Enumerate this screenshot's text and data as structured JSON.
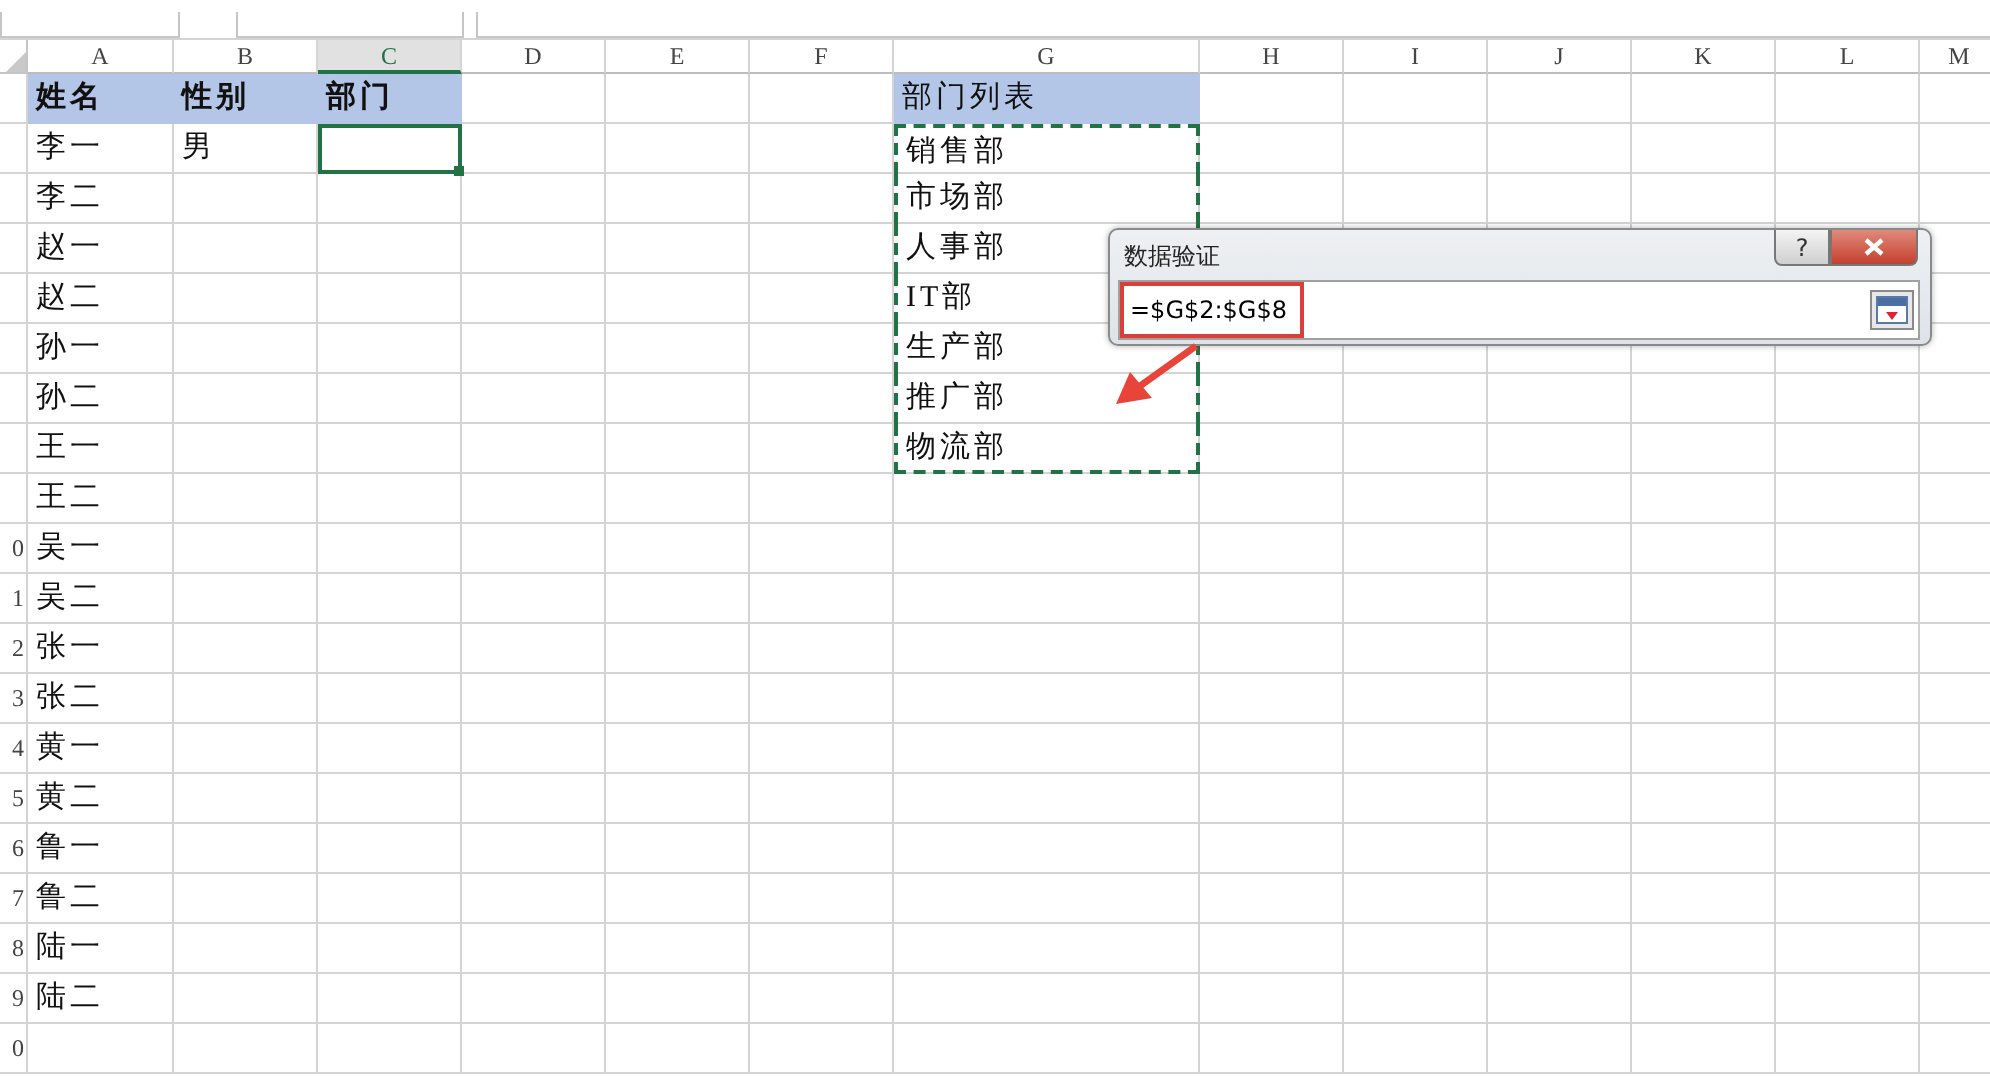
{
  "columns": [
    {
      "label": "A",
      "selected": false
    },
    {
      "label": "B",
      "selected": false
    },
    {
      "label": "C",
      "selected": true
    },
    {
      "label": "D",
      "selected": false
    },
    {
      "label": "E",
      "selected": false
    },
    {
      "label": "F",
      "selected": false
    },
    {
      "label": "G",
      "selected": false
    },
    {
      "label": "H",
      "selected": false
    },
    {
      "label": "I",
      "selected": false
    },
    {
      "label": "J",
      "selected": false
    },
    {
      "label": "K",
      "selected": false
    },
    {
      "label": "L",
      "selected": false
    },
    {
      "label": "M",
      "selected": false
    }
  ],
  "rows": [
    {
      "cells": [
        {
          "text": "姓名",
          "kind": "header"
        },
        {
          "text": "性别",
          "kind": "header"
        },
        {
          "text": "部门",
          "kind": "header"
        },
        null,
        null,
        null,
        {
          "text": "部门列表",
          "kind": "list-header"
        }
      ]
    },
    {
      "cells": [
        {
          "text": "李一"
        },
        {
          "text": "男"
        },
        {
          "selected": true
        },
        null,
        null,
        null,
        {
          "text": "销售部",
          "copied": true
        }
      ]
    },
    {
      "cells": [
        {
          "text": "李二"
        },
        null,
        null,
        null,
        null,
        null,
        {
          "text": "市场部",
          "copied": true
        }
      ]
    },
    {
      "cells": [
        {
          "text": "赵一"
        },
        null,
        null,
        null,
        null,
        null,
        {
          "text": "人事部",
          "copied": true
        }
      ]
    },
    {
      "cells": [
        {
          "text": "赵二"
        },
        null,
        null,
        null,
        null,
        null,
        {
          "text": "IT部",
          "copied": true
        }
      ]
    },
    {
      "cells": [
        {
          "text": "孙一"
        },
        null,
        null,
        null,
        null,
        null,
        {
          "text": "生产部",
          "copied": true
        }
      ]
    },
    {
      "cells": [
        {
          "text": "孙二"
        },
        null,
        null,
        null,
        null,
        null,
        {
          "text": "推广部",
          "copied": true
        }
      ]
    },
    {
      "cells": [
        {
          "text": "王一"
        },
        null,
        null,
        null,
        null,
        null,
        {
          "text": "物流部",
          "copied": true
        }
      ]
    },
    {
      "cells": [
        {
          "text": "王二"
        }
      ]
    },
    {
      "row_label": "0",
      "cells": [
        {
          "text": "吴一"
        }
      ]
    },
    {
      "row_label": "1",
      "cells": [
        {
          "text": "吴二"
        }
      ]
    },
    {
      "row_label": "2",
      "cells": [
        {
          "text": "张一"
        }
      ]
    },
    {
      "row_label": "3",
      "cells": [
        {
          "text": "张二"
        }
      ]
    },
    {
      "row_label": "4",
      "cells": [
        {
          "text": "黄一"
        }
      ]
    },
    {
      "row_label": "5",
      "cells": [
        {
          "text": "黄二"
        }
      ]
    },
    {
      "row_label": "6",
      "cells": [
        {
          "text": "鲁一"
        }
      ]
    },
    {
      "row_label": "7",
      "cells": [
        {
          "text": "鲁二"
        }
      ]
    },
    {
      "row_label": "8",
      "cells": [
        {
          "text": "陆一"
        }
      ]
    },
    {
      "row_label": "9",
      "cells": [
        {
          "text": "陆二"
        }
      ]
    },
    {
      "row_label": "0",
      "cells": []
    }
  ],
  "dialog": {
    "title": "数据验证",
    "help_label": "?",
    "value": "=$G$2:$G$8",
    "highlighted": true
  }
}
